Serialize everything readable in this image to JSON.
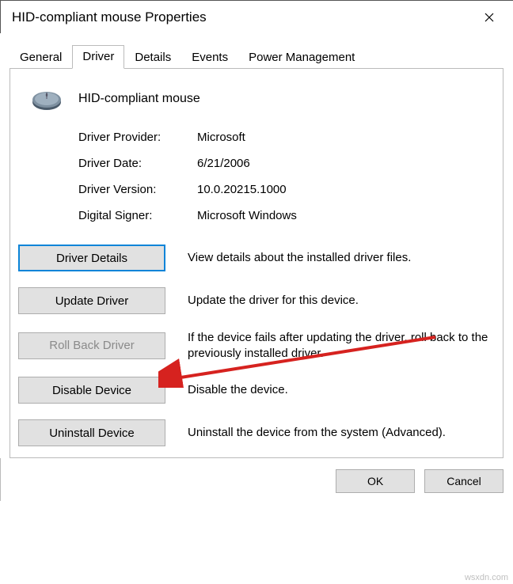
{
  "window": {
    "title": "HID-compliant mouse Properties"
  },
  "tabs": {
    "general": "General",
    "driver": "Driver",
    "details": "Details",
    "events": "Events",
    "power": "Power Management"
  },
  "device": {
    "name": "HID-compliant mouse"
  },
  "info": {
    "provider_label": "Driver Provider:",
    "provider_value": "Microsoft",
    "date_label": "Driver Date:",
    "date_value": "6/21/2006",
    "version_label": "Driver Version:",
    "version_value": "10.0.20215.1000",
    "signer_label": "Digital Signer:",
    "signer_value": "Microsoft Windows"
  },
  "buttons": {
    "details": "Driver Details",
    "details_desc": "View details about the installed driver files.",
    "update": "Update Driver",
    "update_desc": "Update the driver for this device.",
    "rollback": "Roll Back Driver",
    "rollback_desc": "If the device fails after updating the driver, roll back to the previously installed driver.",
    "disable": "Disable Device",
    "disable_desc": "Disable the device.",
    "uninstall": "Uninstall Device",
    "uninstall_desc": "Uninstall the device from the system (Advanced)."
  },
  "footer": {
    "ok": "OK",
    "cancel": "Cancel"
  },
  "watermark": "wsxdn.com"
}
